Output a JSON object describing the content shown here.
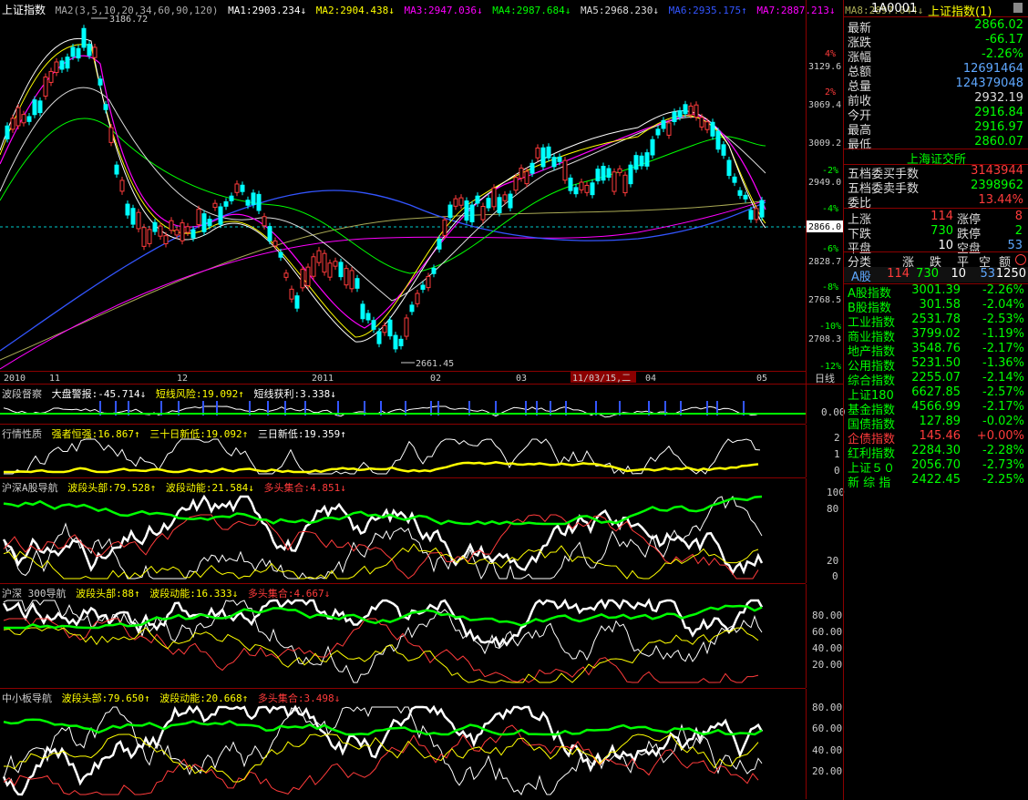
{
  "main_title": {
    "name": "上证指数",
    "ma2": "MA2(3,5,10,20,34,60,90,120)",
    "ma1": "MA1:2903.234↓",
    "ma2v": "MA2:2904.438↓",
    "ma3": "MA3:2947.036↓",
    "ma4": "MA4:2987.684↓",
    "ma5": "MA5:2968.230↓",
    "ma6": "MA6:2935.175↑",
    "ma7": "MA7:2887.213↓",
    "ma8": "MA8:2897.044↓"
  },
  "price_axis": {
    "labels": [
      "4%",
      "3129.6",
      "2%",
      "3069.4",
      "3009.2",
      "-2%",
      "2949.0",
      "-4%",
      "2866.0",
      "-6%",
      "2828.7",
      "-8%",
      "2768.5",
      "-10%",
      "2708.3",
      "-12%"
    ],
    "high_marker": "3186.72",
    "low_marker": "2661.45"
  },
  "date_axis": {
    "labels": [
      "2010",
      "11",
      "12",
      "2011",
      "02",
      "03",
      "11/03/15,二",
      "04",
      "05"
    ],
    "period": "日线"
  },
  "panel1": {
    "name": "波段督察",
    "a": "大盘警报:-45.714↓",
    "b": "短线风险:19.092↑",
    "c": "短线获利:3.338↓",
    "axis": [
      "0.00"
    ]
  },
  "panel2": {
    "name": "行情性质",
    "a": "强者恒强:16.867↑",
    "b": "三十日新低:19.092↑",
    "c": "三日新低:19.359↑",
    "axis": [
      "2",
      "1",
      "0"
    ]
  },
  "panel3": {
    "name": "沪深A股导航",
    "a": "波段头部:79.528↑",
    "b": "波段动能:21.584↓",
    "c": "多头集合:4.851↓",
    "axis": [
      "100",
      "80",
      "20",
      "0"
    ]
  },
  "panel4": {
    "name": "沪深 300导航",
    "a": "波段头部:88↑",
    "b": "波段动能:16.333↓",
    "c": "多头集合:4.667↓",
    "axis": [
      "80.00",
      "60.00",
      "40.00",
      "20.00"
    ]
  },
  "panel5": {
    "name": "中小板导航",
    "a": "波段头部:79.650↑",
    "b": "波段动能:20.668↑",
    "c": "多头集合:3.498↓",
    "axis": [
      "80.00",
      "60.00",
      "40.00",
      "20.00"
    ]
  },
  "quote": {
    "code": "1A0001",
    "name": "上证指数(1)",
    "rows": [
      {
        "k": "最新",
        "v": "2866.02",
        "c": "#00ff00"
      },
      {
        "k": "涨跌",
        "v": "-66.17",
        "c": "#00ff00"
      },
      {
        "k": "涨幅",
        "v": "-2.26%",
        "c": "#00ff00"
      },
      {
        "k": "总额",
        "v": "12691464",
        "c": "#5fa8ff"
      },
      {
        "k": "总量",
        "v": "124379048",
        "c": "#5fa8ff"
      },
      {
        "k": "前收",
        "v": "2932.19",
        "c": "#dddddd"
      },
      {
        "k": "今开",
        "v": "2916.84",
        "c": "#00ff00"
      },
      {
        "k": "最高",
        "v": "2916.97",
        "c": "#00ff00"
      },
      {
        "k": "最低",
        "v": "2860.07",
        "c": "#00ff00"
      }
    ],
    "exchange": "上海证交所",
    "buy_label": "五档委买手数",
    "buy_val": "3143944",
    "sell_label": "五档委卖手数",
    "sell_val": "2398962",
    "ratio_label": "委比",
    "ratio_val": "13.44%",
    "up_label": "上涨",
    "up_val": "114",
    "limit_up_label": "涨停",
    "limit_up_val": "8",
    "down_label": "下跌",
    "down_val": "730",
    "limit_down_label": "跌停",
    "limit_down_val": "2",
    "flat_label": "平盘",
    "flat_val": "10",
    "empty_label": "空盘",
    "empty_val": "53"
  },
  "category": {
    "headers": [
      "分类",
      "涨",
      "跌",
      "平",
      "空",
      "额"
    ],
    "row": {
      "name": "A股",
      "up": "114",
      "down": "730",
      "flat": "10",
      "empty": "53",
      "amount": "1250"
    }
  },
  "indices": [
    {
      "name": "A股指数",
      "value": "3001.39",
      "pct": "-2.26%",
      "c": "#00ff00"
    },
    {
      "name": "B股指数",
      "value": "301.58",
      "pct": "-2.04%",
      "c": "#00ff00"
    },
    {
      "name": "工业指数",
      "value": "2531.78",
      "pct": "-2.53%",
      "c": "#00ff00"
    },
    {
      "name": "商业指数",
      "value": "3799.02",
      "pct": "-1.19%",
      "c": "#00ff00"
    },
    {
      "name": "地产指数",
      "value": "3548.76",
      "pct": "-2.17%",
      "c": "#00ff00"
    },
    {
      "name": "公用指数",
      "value": "5231.50",
      "pct": "-1.36%",
      "c": "#00ff00"
    },
    {
      "name": "综合指数",
      "value": "2255.07",
      "pct": "-2.14%",
      "c": "#00ff00"
    },
    {
      "name": "上证180",
      "value": "6627.85",
      "pct": "-2.57%",
      "c": "#00ff00"
    },
    {
      "name": "基金指数",
      "value": "4566.99",
      "pct": "-2.17%",
      "c": "#00ff00"
    },
    {
      "name": "国债指数",
      "value": "127.89",
      "pct": "-0.02%",
      "c": "#00ff00"
    },
    {
      "name": "企债指数",
      "value": "145.46",
      "pct": "+0.00%",
      "c": "#ff3b3b"
    },
    {
      "name": "红利指数",
      "value": "2284.30",
      "pct": "-2.28%",
      "c": "#00ff00"
    },
    {
      "name": "上证５０",
      "value": "2056.70",
      "pct": "-2.73%",
      "c": "#00ff00"
    },
    {
      "name": "新 综 指",
      "value": "2422.45",
      "pct": "-2.25%",
      "c": "#00ff00"
    }
  ],
  "colors": {
    "up": "#ff3b3b",
    "down": "#00ffff",
    "grid": "#8b0000"
  }
}
